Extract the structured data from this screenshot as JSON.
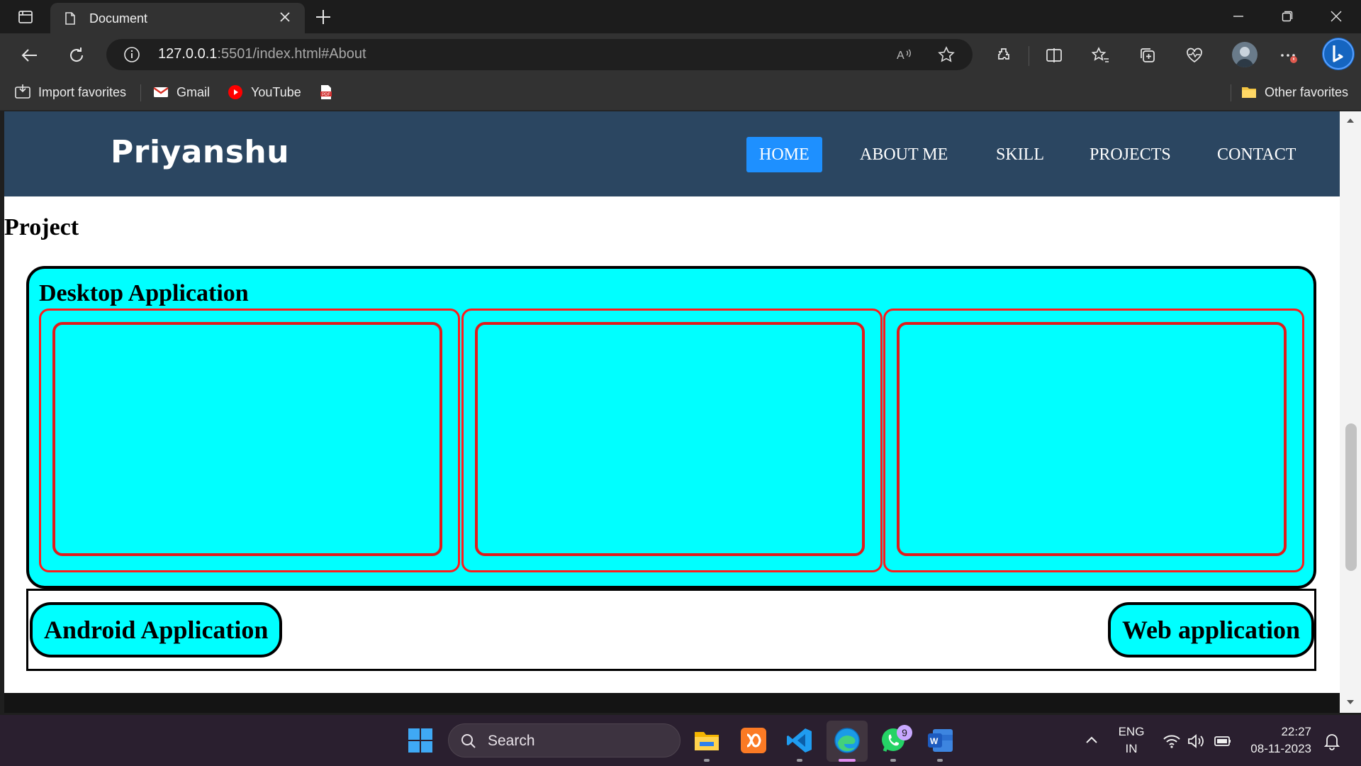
{
  "browser": {
    "tab_title": "Document",
    "url_host": "127.0.0.1",
    "url_rest": ":5501/index.html#About",
    "favorites": {
      "import": "Import favorites",
      "gmail": "Gmail",
      "youtube": "YouTube",
      "other": "Other favorites"
    }
  },
  "site": {
    "logo": "Priyanshu",
    "nav": [
      "HOME",
      "ABOUT ME",
      "SKILL",
      "PROJECTS",
      "CONTACT"
    ],
    "active_nav": "HOME"
  },
  "project": {
    "heading": "Project",
    "desktop_title": "Desktop Application",
    "android_label": "Android Application",
    "web_label": "Web application"
  },
  "taskbar": {
    "search_placeholder": "Search",
    "whatsapp_badge": "9",
    "lang_top": "ENG",
    "lang_bottom": "IN",
    "time": "22:27",
    "date": "08-11-2023"
  },
  "colors": {
    "header_bg": "#2b4661",
    "active_nav_bg": "#1e90ff",
    "card_bg": "#00ffff",
    "card_border": "#ff1a1a"
  }
}
